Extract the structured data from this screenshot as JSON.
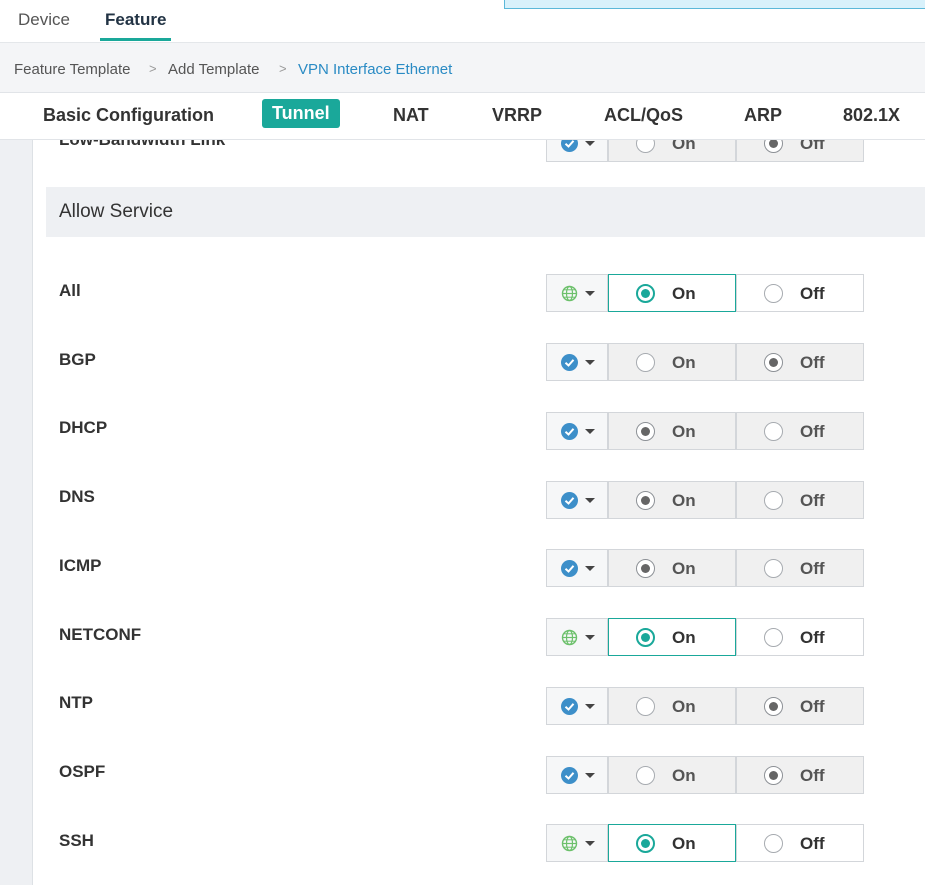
{
  "top_tabs": [
    "Device",
    "Feature"
  ],
  "breadcrumb": [
    "Feature Template",
    "Add Template",
    "VPN Interface Ethernet"
  ],
  "breadcrumb_sep": ">",
  "section_tabs": [
    "Basic Configuration",
    "Tunnel",
    "NAT",
    "VRRP",
    "ACL/QoS",
    "ARP",
    "802.1X"
  ],
  "active_section_tab": "Tunnel",
  "partial_row": {
    "label": "Low-Bandwidth Link",
    "scope": "device-specific",
    "value": "Off"
  },
  "section_title": "Allow Service",
  "option_on": "On",
  "option_off": "Off",
  "services": [
    {
      "label": "All",
      "scope": "global",
      "value": "On"
    },
    {
      "label": "BGP",
      "scope": "default",
      "value": "Off"
    },
    {
      "label": "DHCP",
      "scope": "default",
      "value": "On"
    },
    {
      "label": "DNS",
      "scope": "default",
      "value": "On"
    },
    {
      "label": "ICMP",
      "scope": "default",
      "value": "On"
    },
    {
      "label": "NETCONF",
      "scope": "global",
      "value": "On"
    },
    {
      "label": "NTP",
      "scope": "default",
      "value": "Off"
    },
    {
      "label": "OSPF",
      "scope": "default",
      "value": "Off"
    },
    {
      "label": "SSH",
      "scope": "global",
      "value": "On"
    }
  ],
  "icons": {
    "global": "globe-icon",
    "default": "check-circle-icon",
    "dropdown": "chevron-down-icon"
  },
  "colors": {
    "accent": "#1aa89a",
    "link": "#2a8bc4",
    "check": "#3d8fc9",
    "globe": "#6cc06b"
  }
}
